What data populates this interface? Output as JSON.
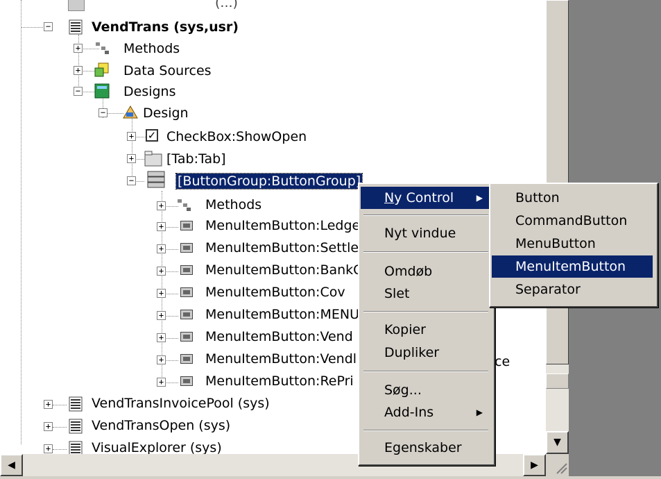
{
  "tree": {
    "top_partial": "(...)",
    "root": {
      "label": "VendTrans (sys,usr)"
    },
    "methods1": "Methods",
    "datasources": "Data Sources",
    "designs": "Designs",
    "design": "Design",
    "checkbox": "CheckBox:ShowOpen",
    "tab": "[Tab:Tab]",
    "buttongroup": "[ButtonGroup:ButtonGroup]",
    "methods2": "Methods",
    "items": [
      "MenuItemButton:Ledge",
      "MenuItemButton:Settle",
      "MenuItemButton:BankC",
      "MenuItemButton:Cov",
      "MenuItemButton:MENU",
      "MenuItemButton:Vend",
      "MenuItemButton:Vendl",
      "MenuItemButton:RePri"
    ],
    "items_partial_right": "ce",
    "siblings": [
      "VendTransInvoicePool (sys)",
      "VendTransOpen (sys)",
      "VisualExplorer (sys)"
    ]
  },
  "context_menu": {
    "ny_control": "Ny Control",
    "nyt_vindue": "Nyt vindue",
    "omdob": "Omdøb",
    "slet": "Slet",
    "kopier": "Kopier",
    "dupliker": "Dupliker",
    "sog": "Søg...",
    "addins": "Add-Ins",
    "egenskaber": "Egenskaber"
  },
  "submenu": {
    "items": [
      "Button",
      "CommandButton",
      "MenuButton",
      "MenuItemButton",
      "Separator"
    ],
    "highlighted": "MenuItemButton"
  },
  "colors": {
    "highlight": "#0a246a",
    "face": "#d4d0c8",
    "shadow": "#808080"
  }
}
